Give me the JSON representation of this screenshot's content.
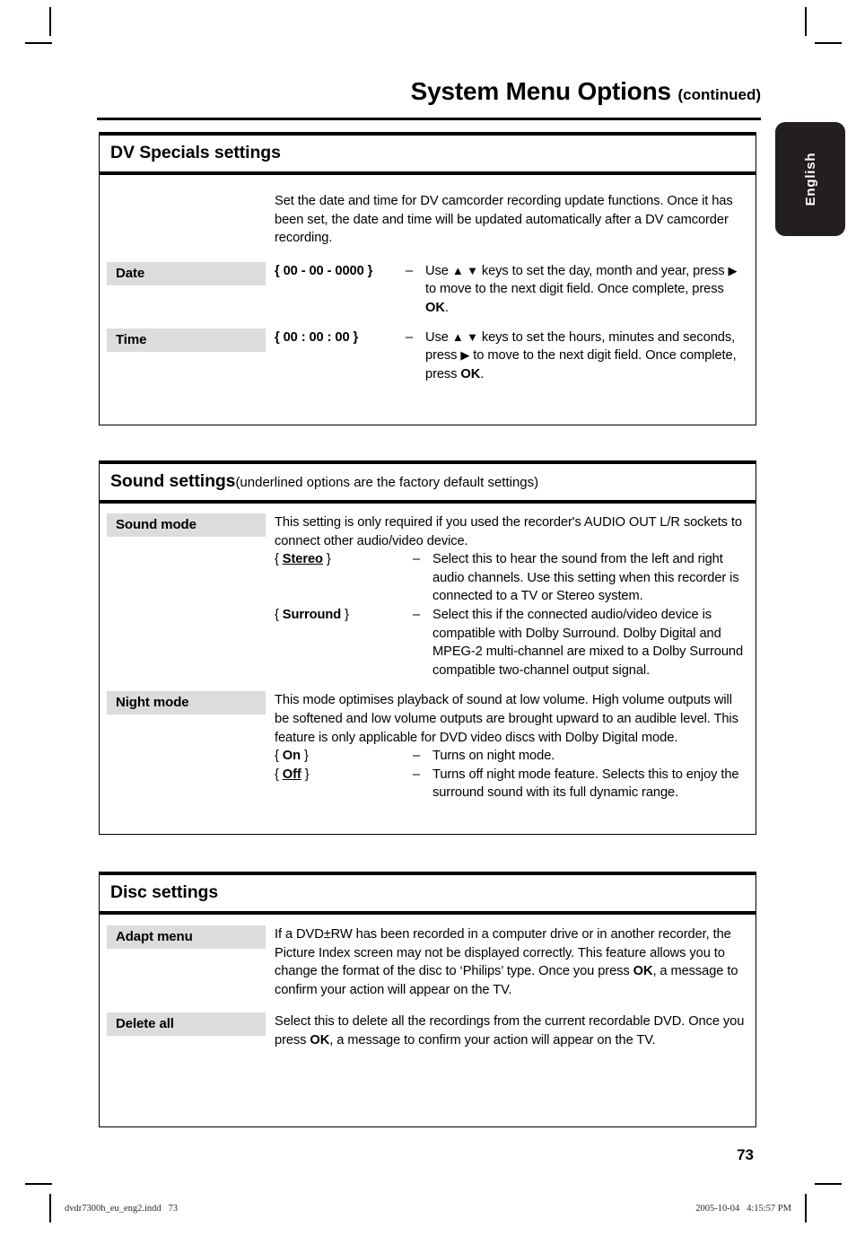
{
  "page": {
    "title": "System Menu Options",
    "title_suffix": "(continued)",
    "language_tab": "English",
    "page_number": "73",
    "imprint_file": "dvdr7300h_eu_eng2.indd   73",
    "imprint_date": "2005-10-04   4:15:57 PM"
  },
  "sections": [
    {
      "heading": "DV Specials settings",
      "subtitle": "",
      "intro": "Set the date and time for DV camcorder recording update functions. Once it has been set, the date and time will be updated automatically after a DV camcorder recording.",
      "rows": [
        {
          "label": "Date",
          "value": "{ 00 - 00 - 0000 }",
          "dash": "–",
          "desc_pre": "Use ",
          "desc_keys": "▲ ▼",
          "desc_mid": " keys to set the day, month and year, press ",
          "desc_arrow": "▶",
          "desc_post": " to move to the next digit field. Once complete, press ",
          "desc_key": "OK",
          "desc_end": "."
        },
        {
          "label": "Time",
          "value": "{ 00 : 00 : 00 }",
          "dash": "–",
          "desc_pre": "Use ",
          "desc_keys": "▲ ▼",
          "desc_mid": " keys to set the hours, minutes and seconds, press ",
          "desc_arrow": "▶",
          "desc_post": " to move to the next digit field. Once complete, press ",
          "desc_key": "OK",
          "desc_end": "."
        }
      ]
    },
    {
      "heading": "Sound settings",
      "subtitle": "(underlined options are the factory default settings)",
      "rows": [
        {
          "label": "Sound mode",
          "para": "This setting is only required if you used the recorder's AUDIO OUT L/R sockets to connect other audio/video device.",
          "options": [
            {
              "open": "{ ",
              "value": "Stereo",
              "close": " }",
              "underline": true,
              "dash": "–",
              "desc": "Select this to hear the sound from the left and right audio channels. Use this setting when this recorder is connected to a TV or Stereo system."
            },
            {
              "open": "{ ",
              "value": "Surround",
              "close": " }",
              "underline": false,
              "dash": "–",
              "desc": "Select this if the connected audio/video device is compatible with Dolby Surround. Dolby Digital and MPEG-2 multi-channel are mixed to a Dolby Surround compatible two-channel output signal."
            }
          ]
        },
        {
          "label": "Night mode",
          "para": "This mode optimises playback of sound at low volume. High volume outputs will be softened and low volume outputs are brought upward to an audible level.  This feature is only applicable for DVD video discs with Dolby Digital mode.",
          "options": [
            {
              "open": "{ ",
              "value": "On",
              "close": " }",
              "underline": false,
              "dash": "–",
              "desc": "Turns on night mode."
            },
            {
              "open": "{ ",
              "value": "Off",
              "close": " }",
              "underline": true,
              "dash": "–",
              "desc": "Turns off night mode feature. Selects this to enjoy the surround sound with its full dynamic range."
            }
          ]
        }
      ]
    },
    {
      "heading": "Disc settings",
      "subtitle": "",
      "rows": [
        {
          "label": "Adapt menu",
          "para_pre": "If a DVD±RW has been recorded in a computer drive or in another recorder, the Picture Index screen may not be displayed correctly. This feature allows you to change the format of the disc to ‘Philips’ type. Once you press ",
          "para_key": "OK",
          "para_post": ", a message to confirm your action will appear on the TV."
        },
        {
          "label": "Delete all",
          "para_pre": "Select this to delete all the recordings from the current recordable DVD. Once you press ",
          "para_key": "OK",
          "para_post": ", a message to confirm your action will appear on the TV."
        }
      ]
    }
  ]
}
